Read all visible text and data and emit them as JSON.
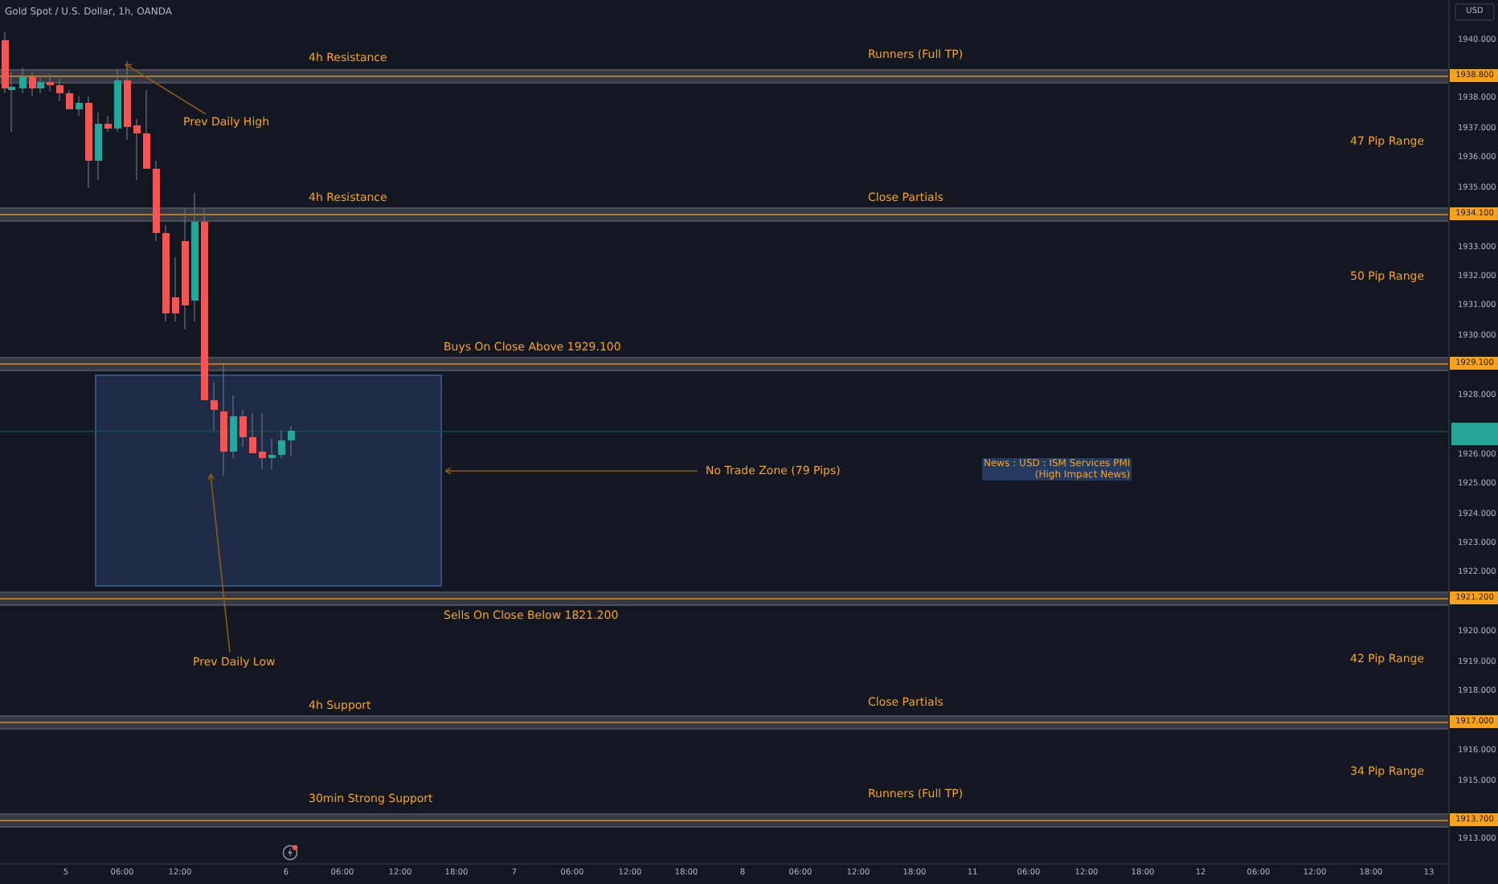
{
  "title": "Gold Spot / U.S. Dollar, 1h, OANDA",
  "currency_button": "USD",
  "price_ticks": [
    "1940.000",
    "1938.000",
    "1937.000",
    "1936.000",
    "1935.000",
    "1933.000",
    "1932.000",
    "1931.000",
    "1930.000",
    "1928.000",
    "1926.000",
    "1925.000",
    "1924.000",
    "1923.000",
    "1922.000",
    "1920.000",
    "1919.000",
    "1918.000",
    "1916.000",
    "1915.000",
    "1913.000"
  ],
  "zones": [
    {
      "badge": "1938.800"
    },
    {
      "badge": "1934.100"
    },
    {
      "badge": "1929.100"
    },
    {
      "badge": "1921.200"
    },
    {
      "badge": "1917.000"
    },
    {
      "badge": "1913.700"
    }
  ],
  "labels": [
    "4h Resistance",
    "Runners (Full TP)",
    "Prev Daily High",
    "47 Pip Range",
    "4h Resistance",
    "Close Partials",
    "50 Pip Range",
    "Buys On Close Above 1929.100",
    "No Trade Zone (79 Pips)",
    "Sells On Close Below 1821.200",
    "Prev Daily Low",
    "42 Pip Range",
    "4h Support",
    "Close Partials",
    "34 Pip Range",
    "30min Strong Support",
    "Runners (Full TP)"
  ],
  "news": {
    "lines": [
      "News : USD : ISM Services PMI",
      "(High Impact News)"
    ]
  },
  "time_ticks": [
    "5",
    "06:00",
    "12:00",
    "6",
    "06:00",
    "12:00",
    "18:00",
    "7",
    "06:00",
    "12:00",
    "18:00",
    "8",
    "06:00",
    "12:00",
    "18:00",
    "11",
    "06:00",
    "12:00",
    "18:00",
    "12",
    "06:00",
    "12:00",
    "18:00",
    "13"
  ]
}
